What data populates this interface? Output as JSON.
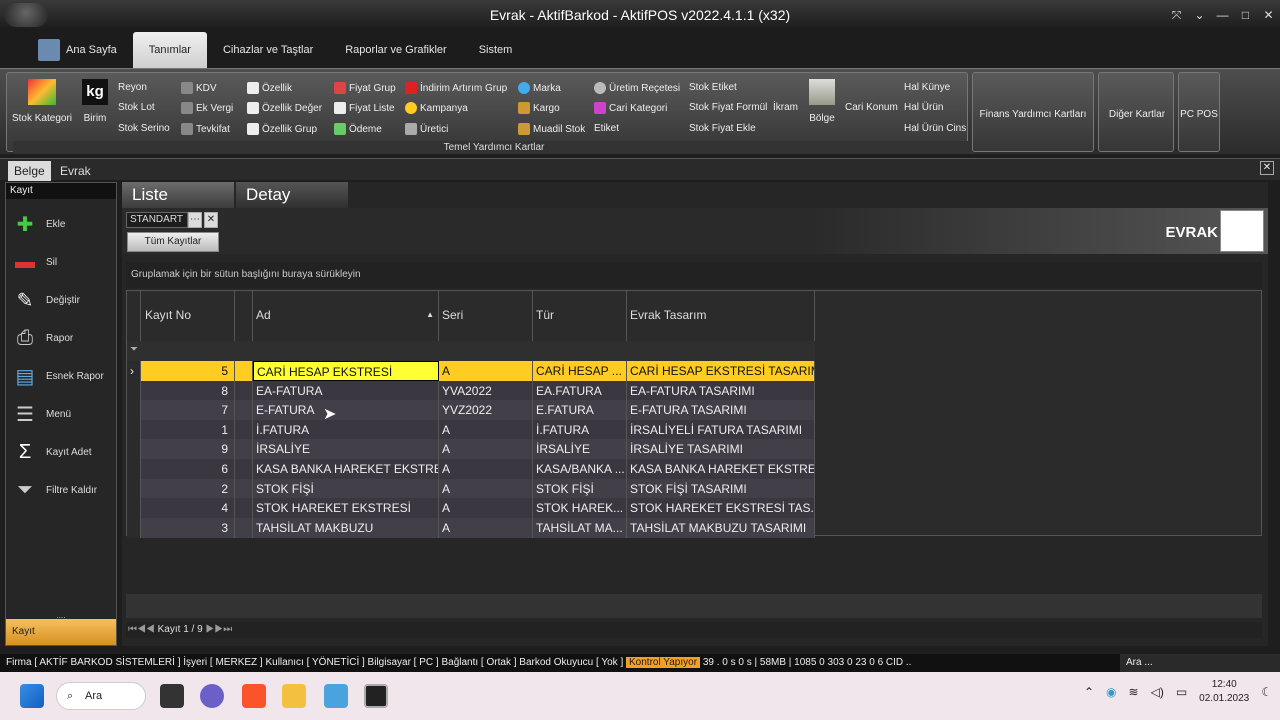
{
  "window": {
    "title": "Evrak - AktifBarkod - AktifPOS v2022.4.1.1 (x32)",
    "controls": [
      "⤧",
      "⌄",
      "—",
      "□",
      "✕"
    ]
  },
  "ribbon_tabs": [
    "Ana Sayfa",
    "Tanımlar",
    "Cihazlar ve Taştlar",
    "Raporlar ve Grafikler",
    "Sistem"
  ],
  "ribbon": {
    "big": [
      {
        "label": "Stok Kategori"
      },
      {
        "label": "Birim",
        "glyph": "kg"
      }
    ],
    "col1": [
      "Reyon",
      "Stok Lot",
      "Stok Serino"
    ],
    "col2": [
      "KDV",
      "Ek Vergi",
      "Tevkifat"
    ],
    "col3": [
      "Özellik",
      "Özellik Değer",
      "Özellik Grup"
    ],
    "col4": [
      "Fiyat Grup",
      "Fiyat Liste",
      "Ödeme"
    ],
    "col5": [
      "İndirim Artırım Grup",
      "Kampanya",
      "Üretici"
    ],
    "col6": [
      "Marka",
      "Kargo",
      "Muadil Stok"
    ],
    "col7": [
      "Üretim Reçetesi",
      "Cari Kategori",
      "Etiket"
    ],
    "col8": [
      "Stok Etiket",
      "Stok Fiyat Formül",
      "Stok Fiyat Ekle"
    ],
    "ikram": "İkram",
    "bolge": "Bölge",
    "cari_konum": "Cari Konum",
    "col9": [
      "Hal Künye",
      "Hal Ürün",
      "Hal Ürün Cins"
    ],
    "group_label": "Temel Yardımcı Kartlar",
    "finans": "Finans Yardımcı Kartları",
    "diger": "Diğer Kartlar",
    "pcpos": "PC POS"
  },
  "doc_tabs": [
    "Belge",
    "Evrak"
  ],
  "left": {
    "header": "Kayıt",
    "buttons": [
      "Ekle",
      "Sil",
      "Değiştir",
      "Rapor",
      "Esnek Rapor",
      "Menü",
      "Kayıt Adet",
      "Filtre Kaldır"
    ],
    "footer": "Kayıt"
  },
  "main": {
    "tabs": [
      "Liste",
      "Detay"
    ],
    "layout": "STANDART",
    "all_records": "Tüm Kayıtlar",
    "title": "EVRAK",
    "group_hint": "Gruplamak için bir sütun başlığını buraya sürükleyin"
  },
  "grid": {
    "columns": [
      "Kayıt No",
      "",
      "Ad",
      "Seri",
      "Tür",
      "Evrak Tasarım"
    ],
    "rows": [
      [
        "5",
        "CARİ HESAP EKSTRESİ",
        "A",
        "CARİ HESAP ...",
        "CARİ HESAP EKSTRESİ TASARIMI"
      ],
      [
        "8",
        "EA-FATURA",
        "YVA2022",
        "EA.FATURA",
        "EA-FATURA TASARIMI"
      ],
      [
        "7",
        "E-FATURA",
        "YVZ2022",
        "E.FATURA",
        "E-FATURA TASARIMI"
      ],
      [
        "1",
        "İ.FATURA",
        "A",
        "İ.FATURA",
        "İRSALİYELİ FATURA TASARIMI"
      ],
      [
        "9",
        "İRSALİYE",
        "A",
        "İRSALİYE",
        "İRSALİYE TASARIMI"
      ],
      [
        "6",
        "KASA BANKA HAREKET EKSTRESİ",
        "A",
        "KASA/BANKA ...",
        "KASA BANKA HAREKET EKSTRE..."
      ],
      [
        "2",
        "STOK FİŞİ",
        "A",
        "STOK FİŞİ",
        "STOK FİŞİ TASARIMI"
      ],
      [
        "4",
        "STOK HAREKET EKSTRESİ",
        "A",
        "STOK HAREK...",
        "STOK HAREKET EKSTRESİ TAS..."
      ],
      [
        "3",
        "TAHSİLAT MAKBUZU",
        "A",
        "TAHSİLAT MA...",
        "TAHSİLAT MAKBUZU TASARIMI"
      ]
    ],
    "pager": "Kayıt 1 / 9"
  },
  "status": {
    "text": "Firma [ AKTİF BARKOD SİSTEMLERİ ]  İşyeri [ MERKEZ ]  Kullanıcı [ YÖNETİCİ ]  Bilgisayar [ PC ]  Bağlantı [ Ortak ]  Barkod Okuyucu [ Yok ]",
    "badge": "Kontrol Yapıyor",
    "tail": "39  .  0 s  0 s  |  58MB  |  1085  0  303  0  23  0  6  CID  ..",
    "search": "Ara ..."
  },
  "taskbar": {
    "search": "Ara",
    "time": "12:40",
    "date": "02.01.2023"
  }
}
